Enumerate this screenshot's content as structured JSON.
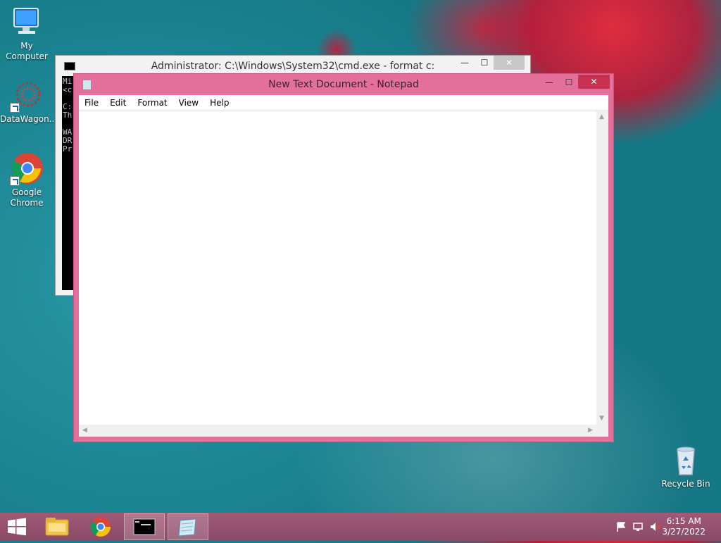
{
  "desktop": {
    "icons": [
      {
        "label": "My Computer"
      },
      {
        "label": "DataWagon..."
      },
      {
        "label": "Google Chrome"
      },
      {
        "label": "Recycle Bin"
      }
    ]
  },
  "cmd_window": {
    "title": "Administrator: C:\\Windows\\System32\\cmd.exe - format  c:",
    "console_lines": [
      "Mi",
      "<c",
      "",
      "C:",
      "Th",
      "",
      "WA",
      "DR",
      "Pr"
    ],
    "buttons": {
      "minimize": "—",
      "maximize": "☐",
      "close": "✕"
    }
  },
  "notepad_window": {
    "title": "New Text Document - Notepad",
    "menu": [
      "File",
      "Edit",
      "Format",
      "View",
      "Help"
    ],
    "content": "",
    "buttons": {
      "minimize": "—",
      "maximize": "☐",
      "close": "✕"
    }
  },
  "taskbar": {
    "clock_time": "6:15 AM",
    "clock_date": "3/27/2022"
  },
  "colors": {
    "notepad_frame": "#e36f9a",
    "taskbar": "#8a4a66",
    "desktop": "#1c8794"
  }
}
